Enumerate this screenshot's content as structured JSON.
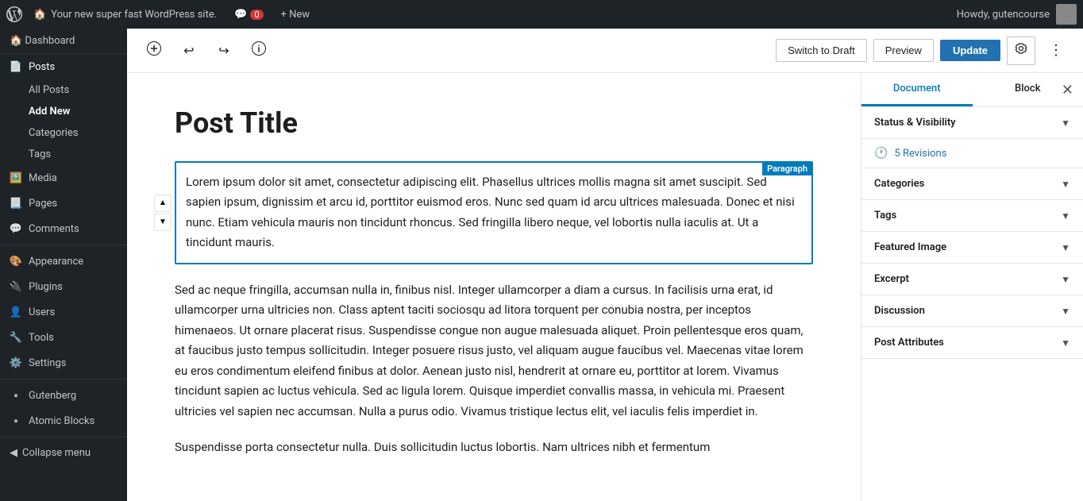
{
  "admin_bar": {
    "logo_alt": "WordPress",
    "site_name": "Your new super fast WordPress site.",
    "comments_count": "0",
    "new_label": "+ New",
    "howdy_text": "Howdy, gutencourse"
  },
  "sidebar": {
    "dashboard_label": "Dashboard",
    "items": [
      {
        "id": "posts",
        "label": "Posts",
        "active": true,
        "icon": "📄"
      },
      {
        "id": "all-posts",
        "label": "All Posts",
        "sub": true
      },
      {
        "id": "add-new",
        "label": "Add New",
        "sub": true,
        "active": true
      },
      {
        "id": "categories",
        "label": "Categories",
        "sub": true
      },
      {
        "id": "tags",
        "label": "Tags",
        "sub": true
      },
      {
        "id": "media",
        "label": "Media",
        "icon": "🖼️"
      },
      {
        "id": "pages",
        "label": "Pages",
        "icon": "📃"
      },
      {
        "id": "comments",
        "label": "Comments",
        "icon": "💬"
      },
      {
        "id": "appearance",
        "label": "Appearance",
        "icon": "🎨"
      },
      {
        "id": "plugins",
        "label": "Plugins",
        "icon": "🔌"
      },
      {
        "id": "users",
        "label": "Users",
        "icon": "👤"
      },
      {
        "id": "tools",
        "label": "Tools",
        "icon": "🔧"
      },
      {
        "id": "settings",
        "label": "Settings",
        "icon": "⚙️"
      },
      {
        "id": "gutenberg",
        "label": "Gutenberg",
        "icon": "●"
      },
      {
        "id": "atomic-blocks",
        "label": "Atomic Blocks",
        "icon": "●"
      }
    ],
    "collapse_label": "Collapse menu"
  },
  "toolbar": {
    "add_block_title": "Add Block",
    "undo_title": "Undo",
    "redo_title": "Redo",
    "info_title": "Content Structure",
    "switch_draft_label": "Switch to Draft",
    "preview_label": "Preview",
    "update_label": "Update",
    "settings_title": "Settings",
    "more_title": "More tools & options"
  },
  "editor": {
    "post_title": "Post Title",
    "paragraph_badge": "Paragraph",
    "block_content": "Lorem ipsum dolor sit amet, consectetur adipiscing elit. Phasellus ultrices mollis magna sit amet suscipit. Sed sapien ipsum, dignissim et arcu id, porttitor euismod eros. Nunc sed quam id arcu ultrices malesuada. Donec et nisi nunc. Etiam vehicula mauris non tincidunt rhoncus. Sed fringilla libero neque, vel lobortis nulla iaculis at. Ut a tincidunt mauris.",
    "paragraph2": "Sed ac neque fringilla, accumsan nulla in, finibus nisl. Integer ullamcorper a diam a cursus. In facilisis urna erat, id ullamcorper urna ultricies non. Class aptent taciti sociosqu ad litora torquent per conubia nostra, per inceptos himenaeos. Ut ornare placerat risus. Suspendisse congue non augue malesuada aliquet. Proin pellentesque eros quam, at faucibus justo tempus sollicitudin. Integer posuere risus justo, vel aliquam augue faucibus vel. Maecenas vitae lorem eu eros condimentum eleifend finibus at dolor. Aenean justo nisl, hendrerit at ornare eu, porttitor at lorem. Vivamus tincidunt sapien ac luctus vehicula. Sed ac ligula lorem. Quisque imperdiet convallis massa, in vehicula mi. Praesent ultricies vel sapien nec accumsan. Nulla a purus odio. Vivamus tristique lectus elit, vel iaculis felis imperdiet in.",
    "paragraph3": "Suspendisse porta consectetur nulla. Duis sollicitudin luctus lobortis. Nam ultrices nibh et fermentum"
  },
  "document_panel": {
    "tab_document": "Document",
    "tab_block": "Block",
    "close_title": "Close Settings",
    "sections": [
      {
        "id": "status-visibility",
        "label": "Status & Visibility",
        "expanded": false
      },
      {
        "id": "revisions",
        "label": "5 Revisions",
        "is_revisions": true
      },
      {
        "id": "categories",
        "label": "Categories",
        "expanded": false
      },
      {
        "id": "tags",
        "label": "Tags",
        "expanded": false
      },
      {
        "id": "featured-image",
        "label": "Featured Image",
        "expanded": false
      },
      {
        "id": "excerpt",
        "label": "Excerpt",
        "expanded": false
      },
      {
        "id": "discussion",
        "label": "Discussion",
        "expanded": false
      },
      {
        "id": "post-attributes",
        "label": "Post Attributes",
        "expanded": false
      }
    ]
  }
}
